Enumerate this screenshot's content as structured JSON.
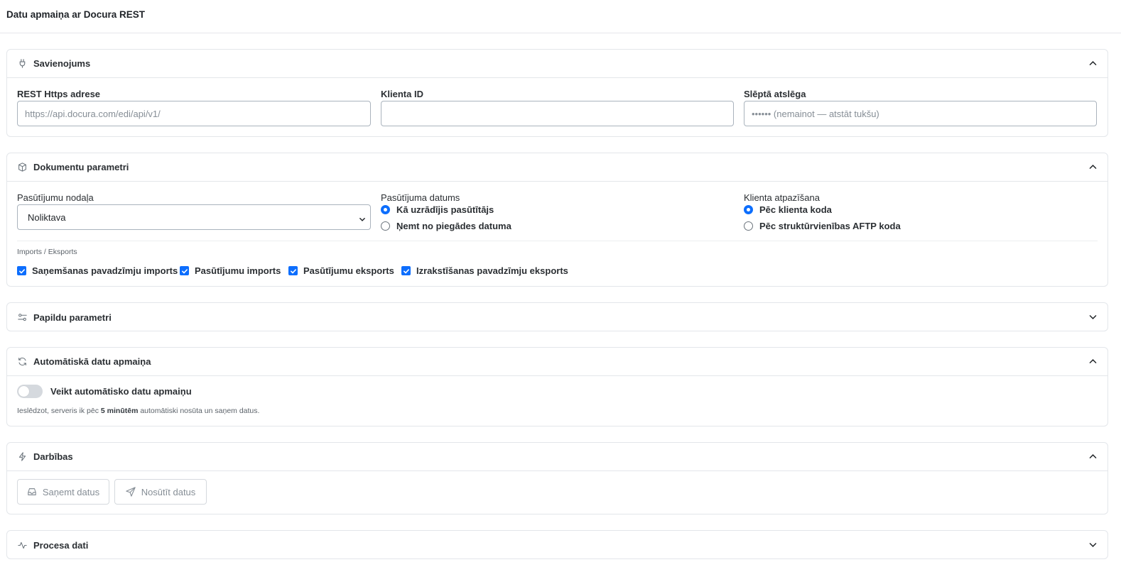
{
  "page": {
    "title": "Datu apmaiņa ar Docura REST"
  },
  "connection": {
    "title": "Savienojums",
    "url_label": "REST Https adrese",
    "url_placeholder": "https://api.docura.com/edi/api/v1/",
    "url_value": "",
    "client_id_label": "Klienta ID",
    "client_id_value": "",
    "secret_label": "Slēptā atslēga",
    "secret_placeholder": "•••••• (nemainot — atstāt tukšu)"
  },
  "documents": {
    "title": "Dokumentu parametri",
    "department_label": "Pasūtījumu nodaļa",
    "department_value": "Noliktava",
    "order_date_label": "Pasūtījuma datums",
    "order_date_options": [
      "Kā uzrādījis pasūtītājs",
      "Ņemt no piegādes datuma"
    ],
    "order_date_selected": 0,
    "client_id_mode_label": "Klienta atpazīšana",
    "client_id_mode_options": [
      "Pēc klienta koda",
      "Pēc struktūrvienības AFTP koda"
    ],
    "client_id_mode_selected": 0,
    "import_export_label": "Imports / Eksports",
    "checkboxes": [
      {
        "label": "Saņemšanas pavadzīmju imports",
        "checked": true
      },
      {
        "label": "Pasūtījumu imports",
        "checked": true
      },
      {
        "label": "Pasūtījumu eksports",
        "checked": true
      },
      {
        "label": "Izrakstīšanas pavadzīmju eksports",
        "checked": true
      }
    ]
  },
  "extra": {
    "title": "Papildu parametri"
  },
  "auto": {
    "title": "Automātiskā datu apmaiņa",
    "toggle_label": "Veikt automātisko datu apmaiņu",
    "toggle_on": false,
    "hint_before": "Ieslēdzot, serveris ik pēc ",
    "hint_bold": "5 minūtēm",
    "hint_after": " automātiski nosūta un saņem datus."
  },
  "actions": {
    "title": "Darbības",
    "receive_label": "Saņemt datus",
    "send_label": "Nosūtīt datus"
  },
  "process": {
    "title": "Procesa dati"
  },
  "colors": {
    "accent": "#0d6efd",
    "border": "#e3e6ea",
    "muted": "#868e96"
  }
}
